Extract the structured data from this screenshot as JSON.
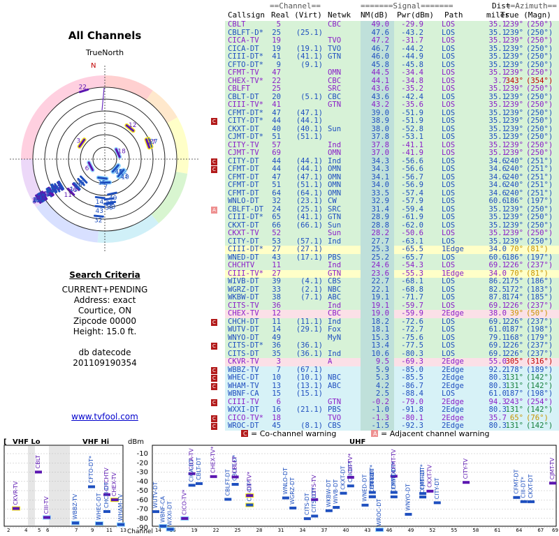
{
  "left": {
    "title": "All Channels",
    "north_label": "TrueNorth",
    "n_marker": "N",
    "criteria_title": "Search Criteria",
    "criteria_lines": [
      "CURRENT+PENDING",
      "Address: exact",
      "Courtice, ON",
      "Zipcode 00000",
      "Height: 15.0 ft."
    ],
    "db_label": "db datecode",
    "db_value": "201109190354",
    "link": "www.tvfool.com"
  },
  "headers": {
    "channel_group": "==Channel==",
    "signal_group": "=======Signal=======",
    "dist_top": "Dist",
    "azimuth_group": "==Azimuth==",
    "callsign": "Callsign",
    "real_virt": "Real (Virt)",
    "netwk": "Netwk",
    "nm": "NM(dB)",
    "pwr": "Pwr(dBm)",
    "path": "Path",
    "miles": "miles",
    "az": "True (Magn)"
  },
  "colors": {
    "blue": "#1f4fbf",
    "purple": "#8a1ec8",
    "red": "#c00000",
    "orange": "#c89400",
    "green": "#15803d",
    "row_green": "#d7f2d7",
    "row_yellow": "#ffffc8",
    "row_pink": "#fbe0e7",
    "row_blue": "#d7f2f7",
    "nm_shade": "#bfe0da"
  },
  "chart_data": {
    "type": "table",
    "rows": [
      {
        "callsign": "CBLT",
        "real": "5",
        "virt": "",
        "netwk": "CBC",
        "nm": "49.0",
        "pwr": "-29.9",
        "path": "LOS",
        "dist": "35.1",
        "true": "239°",
        "magn": "(250°)",
        "color": "purple",
        "bg": "green",
        "badge": ""
      },
      {
        "callsign": "CBLFT-D*",
        "real": "25",
        "virt": "(25.1)",
        "netwk": "",
        "nm": "47.6",
        "pwr": "-43.2",
        "path": "LOS",
        "dist": "35.1",
        "true": "239°",
        "magn": "(250°)",
        "color": "blue",
        "bg": "green",
        "badge": ""
      },
      {
        "callsign": "CICA-TV",
        "real": "19",
        "virt": "",
        "netwk": "TVO",
        "nm": "47.2",
        "pwr": "-31.7",
        "path": "LOS",
        "dist": "35.1",
        "true": "239°",
        "magn": "(250°)",
        "color": "purple",
        "bg": "green",
        "badge": ""
      },
      {
        "callsign": "CICA-DT",
        "real": "19",
        "virt": "(19.1)",
        "netwk": "TVO",
        "nm": "46.7",
        "pwr": "-44.2",
        "path": "LOS",
        "dist": "35.1",
        "true": "239°",
        "magn": "(250°)",
        "color": "blue",
        "bg": "green",
        "badge": ""
      },
      {
        "callsign": "CIII-DT*",
        "real": "41",
        "virt": "(41.1)",
        "netwk": "GTN",
        "nm": "46.0",
        "pwr": "-44.9",
        "path": "LOS",
        "dist": "35.1",
        "true": "239°",
        "magn": "(250°)",
        "color": "blue",
        "bg": "green",
        "badge": ""
      },
      {
        "callsign": "CFTO-DT*",
        "real": "9",
        "virt": "(9.1)",
        "netwk": "",
        "nm": "45.8",
        "pwr": "-45.8",
        "path": "LOS",
        "dist": "35.1",
        "true": "239°",
        "magn": "(250°)",
        "color": "blue",
        "bg": "green",
        "badge": ""
      },
      {
        "callsign": "CFMT-TV",
        "real": "47",
        "virt": "",
        "netwk": "OMN",
        "nm": "44.5",
        "pwr": "-34.4",
        "path": "LOS",
        "dist": "35.1",
        "true": "239°",
        "magn": "(250°)",
        "color": "purple",
        "bg": "green",
        "badge": ""
      },
      {
        "callsign": "CHEX-TV*",
        "real": "22",
        "virt": "",
        "netwk": "CBC",
        "nm": "44.1",
        "pwr": "-34.8",
        "path": "LOS",
        "dist": "3.7",
        "true": "343°",
        "magn": "(354°)",
        "color": "purple",
        "bg": "green",
        "badge": "",
        "azcolor": "red"
      },
      {
        "callsign": "CBLFT",
        "real": "25",
        "virt": "",
        "netwk": "SRC",
        "nm": "43.6",
        "pwr": "-35.2",
        "path": "LOS",
        "dist": "35.1",
        "true": "239°",
        "magn": "(250°)",
        "color": "purple",
        "bg": "green",
        "badge": ""
      },
      {
        "callsign": "CBLT-DT",
        "real": "20",
        "virt": "(5.1)",
        "netwk": "CBC",
        "nm": "43.6",
        "pwr": "-42.4",
        "path": "LOS",
        "dist": "35.1",
        "true": "239°",
        "magn": "(250°)",
        "color": "blue",
        "bg": "green",
        "badge": ""
      },
      {
        "callsign": "CIII-TV*",
        "real": "41",
        "virt": "",
        "netwk": "GTN",
        "nm": "43.2",
        "pwr": "-35.6",
        "path": "LOS",
        "dist": "35.1",
        "true": "239°",
        "magn": "(250°)",
        "color": "purple",
        "bg": "green",
        "badge": ""
      },
      {
        "callsign": "CFMT-DT*",
        "real": "47",
        "virt": "(47.1)",
        "netwk": "",
        "nm": "39.0",
        "pwr": "-51.9",
        "path": "LOS",
        "dist": "35.1",
        "true": "239°",
        "magn": "(250°)",
        "color": "blue",
        "bg": "green",
        "badge": ""
      },
      {
        "callsign": "CITY-DT*",
        "real": "44",
        "virt": "(44.1)",
        "netwk": "",
        "nm": "38.9",
        "pwr": "-51.9",
        "path": "LOS",
        "dist": "35.1",
        "true": "239°",
        "magn": "(250°)",
        "color": "blue",
        "bg": "green",
        "badge": "co"
      },
      {
        "callsign": "CKXT-DT",
        "real": "40",
        "virt": "(40.1)",
        "netwk": "Sun",
        "nm": "38.0",
        "pwr": "-52.8",
        "path": "LOS",
        "dist": "35.1",
        "true": "239°",
        "magn": "(250°)",
        "color": "blue",
        "bg": "green",
        "badge": ""
      },
      {
        "callsign": "CJMT-DT*",
        "real": "51",
        "virt": "(51.1)",
        "netwk": "",
        "nm": "37.8",
        "pwr": "-53.1",
        "path": "LOS",
        "dist": "35.1",
        "true": "239°",
        "magn": "(250°)",
        "color": "blue",
        "bg": "green",
        "badge": ""
      },
      {
        "callsign": "CITY-TV",
        "real": "57",
        "virt": "",
        "netwk": "Ind",
        "nm": "37.8",
        "pwr": "-41.1",
        "path": "LOS",
        "dist": "35.1",
        "true": "239°",
        "magn": "(250°)",
        "color": "purple",
        "bg": "green",
        "badge": ""
      },
      {
        "callsign": "CJMT-TV",
        "real": "69",
        "virt": "",
        "netwk": "OMN",
        "nm": "37.0",
        "pwr": "-41.9",
        "path": "LOS",
        "dist": "35.1",
        "true": "239°",
        "magn": "(250°)",
        "color": "purple",
        "bg": "green",
        "badge": ""
      },
      {
        "callsign": "CITY-DT",
        "real": "44",
        "virt": "(44.1)",
        "netwk": "Ind",
        "nm": "34.3",
        "pwr": "-56.6",
        "path": "LOS",
        "dist": "34.6",
        "true": "240°",
        "magn": "(251°)",
        "color": "blue",
        "bg": "green",
        "badge": "co"
      },
      {
        "callsign": "CFMT-DT",
        "real": "44",
        "virt": "(44.1)",
        "netwk": "OMN",
        "nm": "34.3",
        "pwr": "-56.6",
        "path": "LOS",
        "dist": "34.6",
        "true": "240°",
        "magn": "(251°)",
        "color": "blue",
        "bg": "green",
        "badge": "co"
      },
      {
        "callsign": "CFMT-DT",
        "real": "47",
        "virt": "(47.1)",
        "netwk": "OMN",
        "nm": "34.1",
        "pwr": "-56.7",
        "path": "LOS",
        "dist": "34.6",
        "true": "240°",
        "magn": "(251°)",
        "color": "blue",
        "bg": "green",
        "badge": ""
      },
      {
        "callsign": "CFMT-DT",
        "real": "51",
        "virt": "(51.1)",
        "netwk": "OMN",
        "nm": "34.0",
        "pwr": "-56.9",
        "path": "LOS",
        "dist": "34.6",
        "true": "240°",
        "magn": "(251°)",
        "color": "blue",
        "bg": "green",
        "badge": ""
      },
      {
        "callsign": "CFMT-DT",
        "real": "64",
        "virt": "(64.1)",
        "netwk": "OMN",
        "nm": "33.5",
        "pwr": "-57.4",
        "path": "LOS",
        "dist": "34.6",
        "true": "240°",
        "magn": "(251°)",
        "color": "blue",
        "bg": "green",
        "badge": ""
      },
      {
        "callsign": "WNLO-DT",
        "real": "32",
        "virt": "(23.1)",
        "netwk": "CW",
        "nm": "32.9",
        "pwr": "-57.9",
        "path": "LOS",
        "dist": "60.6",
        "true": "186°",
        "magn": "(197°)",
        "color": "blue",
        "bg": "green",
        "badge": ""
      },
      {
        "callsign": "CBLFT-DT",
        "real": "24",
        "virt": "(25.1)",
        "netwk": "SRC",
        "nm": "31.4",
        "pwr": "-59.4",
        "path": "LOS",
        "dist": "35.1",
        "true": "239°",
        "magn": "(250°)",
        "color": "blue",
        "bg": "green",
        "badge": "adj"
      },
      {
        "callsign": "CIII-DT*",
        "real": "65",
        "virt": "(41.1)",
        "netwk": "GTN",
        "nm": "28.9",
        "pwr": "-61.9",
        "path": "LOS",
        "dist": "35.1",
        "true": "239°",
        "magn": "(250°)",
        "color": "blue",
        "bg": "green",
        "badge": ""
      },
      {
        "callsign": "CKXT-DT",
        "real": "66",
        "virt": "(66.1)",
        "netwk": "Sun",
        "nm": "28.8",
        "pwr": "-62.0",
        "path": "LOS",
        "dist": "35.1",
        "true": "239°",
        "magn": "(250°)",
        "color": "blue",
        "bg": "green",
        "badge": ""
      },
      {
        "callsign": "CKXT-TV",
        "real": "52",
        "virt": "",
        "netwk": "Sun",
        "nm": "28.2",
        "pwr": "-50.6",
        "path": "LOS",
        "dist": "35.1",
        "true": "239°",
        "magn": "(250°)",
        "color": "purple",
        "bg": "green",
        "badge": ""
      },
      {
        "callsign": "CITY-DT",
        "real": "53",
        "virt": "(57.1)",
        "netwk": "Ind",
        "nm": "27.7",
        "pwr": "-63.1",
        "path": "LOS",
        "dist": "35.1",
        "true": "239°",
        "magn": "(250°)",
        "color": "blue",
        "bg": "green",
        "badge": ""
      },
      {
        "callsign": "CIII-DT*",
        "real": "27",
        "virt": "(27.1)",
        "netwk": "",
        "nm": "25.3",
        "pwr": "-65.5",
        "path": "1Edge",
        "dist": "34.0",
        "true": "70°",
        "magn": "(81°)",
        "color": "blue",
        "bg": "yellow",
        "badge": "",
        "azcolor": "orange"
      },
      {
        "callsign": "WNED-DT",
        "real": "43",
        "virt": "(17.1)",
        "netwk": "PBS",
        "nm": "25.2",
        "pwr": "-65.7",
        "path": "LOS",
        "dist": "60.6",
        "true": "186°",
        "magn": "(197°)",
        "color": "blue",
        "bg": "green",
        "badge": ""
      },
      {
        "callsign": "CHCHTV",
        "real": "11",
        "virt": "",
        "netwk": "Ind",
        "nm": "24.6",
        "pwr": "-54.3",
        "path": "LOS",
        "dist": "69.1",
        "true": "226°",
        "magn": "(237°)",
        "color": "purple",
        "bg": "green",
        "badge": ""
      },
      {
        "callsign": "CIII-TV*",
        "real": "27",
        "virt": "",
        "netwk": "GTN",
        "nm": "23.6",
        "pwr": "-55.3",
        "path": "1Edge",
        "dist": "34.0",
        "true": "70°",
        "magn": "(81°)",
        "color": "purple",
        "bg": "yellow",
        "badge": "",
        "azcolor": "orange"
      },
      {
        "callsign": "WIVB-DT",
        "real": "39",
        "virt": "(4.1)",
        "netwk": "CBS",
        "nm": "22.7",
        "pwr": "-68.1",
        "path": "LOS",
        "dist": "86.2",
        "true": "175°",
        "magn": "(186°)",
        "color": "blue",
        "bg": "green",
        "badge": ""
      },
      {
        "callsign": "WGRZ-DT",
        "real": "33",
        "virt": "(2.1)",
        "netwk": "NBC",
        "nm": "22.1",
        "pwr": "-68.8",
        "path": "LOS",
        "dist": "82.5",
        "true": "172°",
        "magn": "(183°)",
        "color": "blue",
        "bg": "green",
        "badge": ""
      },
      {
        "callsign": "WKBW-DT",
        "real": "38",
        "virt": "(7.1)",
        "netwk": "ABC",
        "nm": "19.1",
        "pwr": "-71.7",
        "path": "LOS",
        "dist": "87.8",
        "true": "174°",
        "magn": "(185°)",
        "color": "blue",
        "bg": "green",
        "badge": ""
      },
      {
        "callsign": "CITS-TV",
        "real": "36",
        "virt": "",
        "netwk": "Ind",
        "nm": "19.1",
        "pwr": "-59.7",
        "path": "LOS",
        "dist": "69.1",
        "true": "226°",
        "magn": "(237°)",
        "color": "purple",
        "bg": "green",
        "badge": ""
      },
      {
        "callsign": "CHEX-TV",
        "real": "12",
        "virt": "",
        "netwk": "CBC",
        "nm": "19.0",
        "pwr": "-59.9",
        "path": "2Edge",
        "dist": "38.0",
        "true": "39°",
        "magn": "(50°)",
        "color": "purple",
        "bg": "pink",
        "badge": "",
        "azcolor": "orange"
      },
      {
        "callsign": "CHCH-DT",
        "real": "11",
        "virt": "(11.1)",
        "netwk": "Ind",
        "nm": "18.2",
        "pwr": "-72.6",
        "path": "LOS",
        "dist": "69.1",
        "true": "226°",
        "magn": "(237°)",
        "color": "blue",
        "bg": "green",
        "badge": "co"
      },
      {
        "callsign": "WUTV-DT",
        "real": "14",
        "virt": "(29.1)",
        "netwk": "Fox",
        "nm": "18.1",
        "pwr": "-72.7",
        "path": "LOS",
        "dist": "61.0",
        "true": "187°",
        "magn": "(198°)",
        "color": "blue",
        "bg": "green",
        "badge": ""
      },
      {
        "callsign": "WNYO-DT",
        "real": "49",
        "virt": "",
        "netwk": "MyN",
        "nm": "15.3",
        "pwr": "-75.6",
        "path": "LOS",
        "dist": "79.1",
        "true": "168°",
        "magn": "(179°)",
        "color": "blue",
        "bg": "green",
        "badge": ""
      },
      {
        "callsign": "CITS-DT*",
        "real": "36",
        "virt": "(36.1)",
        "netwk": "",
        "nm": "13.4",
        "pwr": "-77.5",
        "path": "LOS",
        "dist": "69.1",
        "true": "226°",
        "magn": "(237°)",
        "color": "blue",
        "bg": "green",
        "badge": "co"
      },
      {
        "callsign": "CITS-DT",
        "real": "35",
        "virt": "(36.1)",
        "netwk": "Ind",
        "nm": "10.6",
        "pwr": "-80.3",
        "path": "LOS",
        "dist": "69.1",
        "true": "226°",
        "magn": "(237°)",
        "color": "blue",
        "bg": "green",
        "badge": ""
      },
      {
        "callsign": "CKVR-TV",
        "real": "3",
        "virt": "",
        "netwk": "A",
        "nm": "9.5",
        "pwr": "-69.3",
        "path": "2Edge",
        "dist": "55.0",
        "true": "305°",
        "magn": "(316°)",
        "color": "purple",
        "bg": "pink",
        "badge": "",
        "azcolor": "red"
      },
      {
        "callsign": "WBBZ-TV",
        "real": "7",
        "virt": "(67.1)",
        "netwk": "",
        "nm": "5.9",
        "pwr": "-85.0",
        "path": "2Edge",
        "dist": "92.2",
        "true": "178°",
        "magn": "(189°)",
        "color": "blue",
        "bg": "blue",
        "badge": "co"
      },
      {
        "callsign": "WHEC-DT",
        "real": "10",
        "virt": "(10.1)",
        "netwk": "NBC",
        "nm": "5.3",
        "pwr": "-85.5",
        "path": "2Edge",
        "dist": "80.3",
        "true": "131°",
        "magn": "(142°)",
        "color": "blue",
        "bg": "blue",
        "badge": "co",
        "azcolor": "green"
      },
      {
        "callsign": "WHAM-TV",
        "real": "13",
        "virt": "(13.1)",
        "netwk": "ABC",
        "nm": "4.2",
        "pwr": "-86.7",
        "path": "2Edge",
        "dist": "80.3",
        "true": "131°",
        "magn": "(142°)",
        "color": "blue",
        "bg": "blue",
        "badge": "co",
        "azcolor": "green"
      },
      {
        "callsign": "WBNF-CA",
        "real": "15",
        "virt": "(15.1)",
        "netwk": "",
        "nm": "2.5",
        "pwr": "-88.4",
        "path": "LOS",
        "dist": "61.0",
        "true": "187°",
        "magn": "(198°)",
        "color": "blue",
        "bg": "blue",
        "badge": ""
      },
      {
        "callsign": "CIII-TV",
        "real": "6",
        "virt": "",
        "netwk": "GTN",
        "nm": "-0.2",
        "pwr": "-79.0",
        "path": "2Edge",
        "dist": "94.3",
        "true": "243°",
        "magn": "(254°)",
        "color": "purple",
        "bg": "blue",
        "badge": "co"
      },
      {
        "callsign": "WXXI-DT",
        "real": "16",
        "virt": "(21.1)",
        "netwk": "PBS",
        "nm": "-1.0",
        "pwr": "-91.8",
        "path": "2Edge",
        "dist": "80.3",
        "true": "131°",
        "magn": "(142°)",
        "color": "blue",
        "bg": "blue",
        "badge": "",
        "azcolor": "green"
      },
      {
        "callsign": "CICO-TV*",
        "real": "18",
        "virt": "",
        "netwk": "TVO",
        "nm": "-1.3",
        "pwr": "-80.1",
        "path": "2Edge",
        "dist": "35.7",
        "true": "65°",
        "magn": "(76°)",
        "color": "purple",
        "bg": "blue",
        "badge": "co",
        "azcolor": "orange"
      },
      {
        "callsign": "WROC-DT",
        "real": "45",
        "virt": "(8.1)",
        "netwk": "CBS",
        "nm": "-1.5",
        "pwr": "-92.3",
        "path": "2Edge",
        "dist": "80.3",
        "true": "131°",
        "magn": "(142°)",
        "color": "blue",
        "bg": "blue",
        "badge": "co",
        "azcolor": "green"
      }
    ],
    "spectrum": {
      "ylabel": "dBm",
      "yticks": [
        -10,
        -20,
        -30,
        -40,
        -50,
        -60,
        -70,
        -80,
        -90
      ],
      "vhf_lo_label": "VHF Lo",
      "vhf_hi_label": "VHF Hi",
      "uhf_label": "UHF",
      "x_axis_label": "Channel",
      "lo_ticks": [
        "2",
        "4",
        "5",
        "6"
      ],
      "hi_ticks": [
        "7",
        "9",
        "11",
        "13"
      ],
      "uhf_ticks": [
        "14",
        "16",
        "19",
        "22",
        "25",
        "28",
        "31",
        "34",
        "37",
        "40",
        "43",
        "46",
        "49",
        "52",
        "55",
        "58",
        "61",
        "64",
        "67",
        "69"
      ],
      "co_legend": "= Co-channel warning",
      "adj_legend": "= Adjacent channel warning",
      "co_badge": "C",
      "adj_badge": "A"
    }
  }
}
